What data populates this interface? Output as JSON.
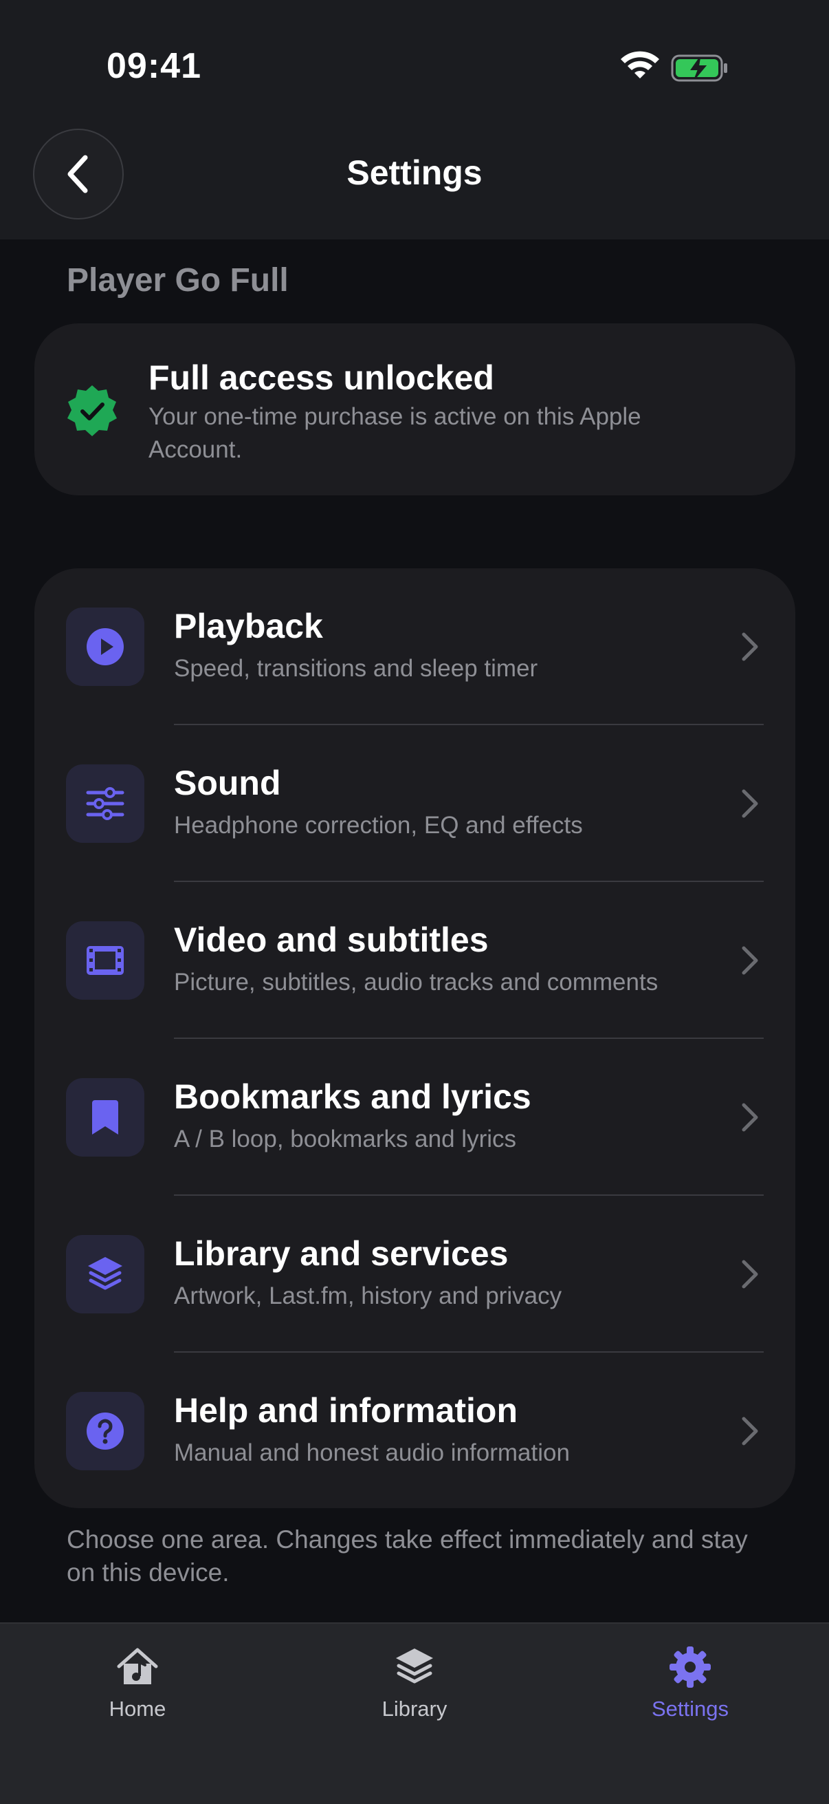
{
  "status_bar": {
    "time": "09:41"
  },
  "header": {
    "title": "Settings",
    "back_icon": "chevron-left-icon"
  },
  "section": {
    "title": "Player Go Full"
  },
  "purchase": {
    "title": "Full access unlocked",
    "description": "Your one-time purchase is active on this Apple Account.",
    "icon": "verified-badge-icon",
    "icon_color": "#1fa855"
  },
  "settings_items": [
    {
      "title": "Playback",
      "subtitle": "Speed, transitions and sleep timer",
      "icon": "play-circle-icon"
    },
    {
      "title": "Sound",
      "subtitle": "Headphone correction, EQ and effects",
      "icon": "sliders-icon"
    },
    {
      "title": "Video and subtitles",
      "subtitle": "Picture, subtitles, audio tracks and comments",
      "icon": "film-icon"
    },
    {
      "title": "Bookmarks and lyrics",
      "subtitle": "A / B loop, bookmarks and lyrics",
      "icon": "bookmark-icon"
    },
    {
      "title": "Library and services",
      "subtitle": "Artwork, Last.fm, history and privacy",
      "icon": "stack-icon"
    },
    {
      "title": "Help and information",
      "subtitle": "Manual and honest audio information",
      "icon": "question-circle-icon"
    }
  ],
  "footer": {
    "note": "Choose one area. Changes take effect immediately and stay on this device."
  },
  "tabbar": {
    "tabs": [
      {
        "label": "Home",
        "icon": "home-music-icon",
        "active": false
      },
      {
        "label": "Library",
        "icon": "stack-icon",
        "active": false
      },
      {
        "label": "Settings",
        "icon": "gear-icon",
        "active": true
      }
    ]
  },
  "colors": {
    "accent": "#7b73f0",
    "background": "#0f1014",
    "card": "#1c1c20",
    "success": "#1fa855"
  }
}
